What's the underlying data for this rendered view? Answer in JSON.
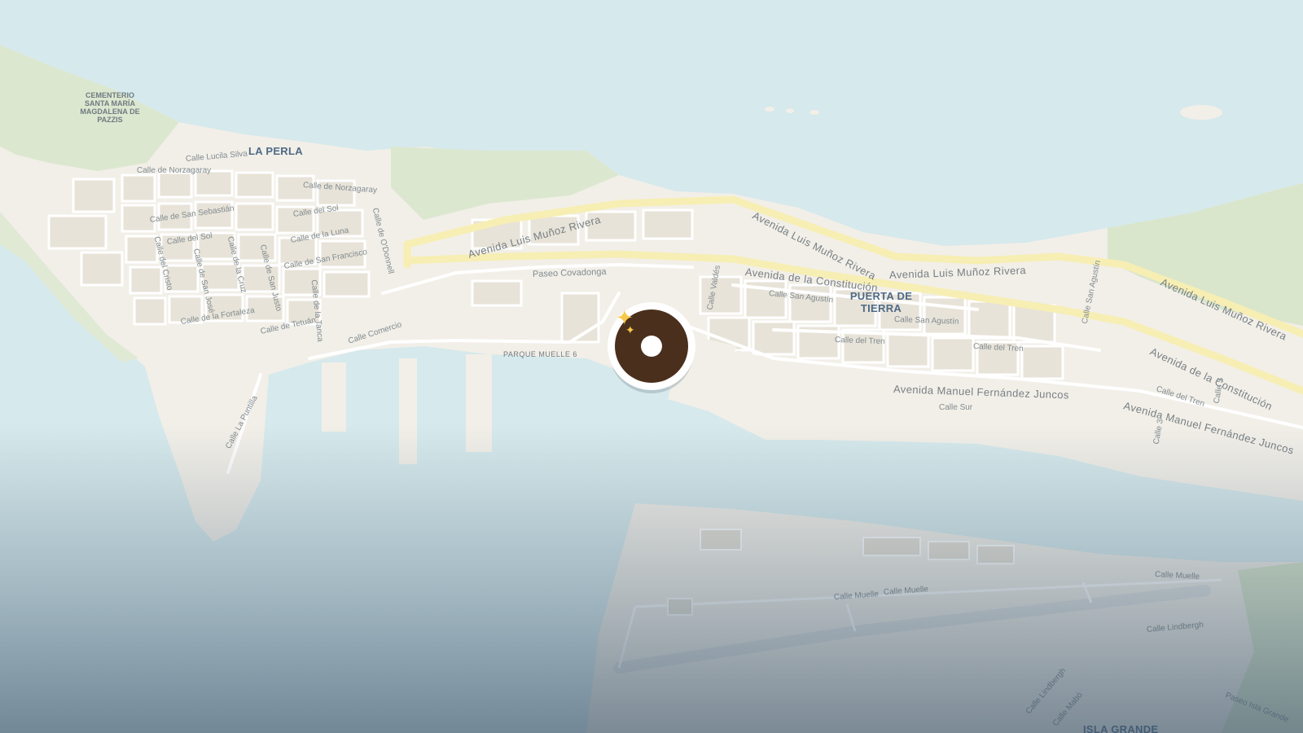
{
  "map": {
    "colors": {
      "water": "#d6e9ec",
      "land": "#f2efe8",
      "park": "#d9e6cc",
      "major_road": "#f7eeb4",
      "building": "#e6e1d6"
    },
    "neighborhoods": [
      "LA PERLA",
      "PUERTA DE TIERRA",
      "ISLA GRANDE"
    ],
    "poi": {
      "cemetery": "CEMENTERIO SANTA MARÍA MAGDALENA DE PAZZIS",
      "pier": "PARQUE MUELLE 6"
    },
    "roads": {
      "lucila_silva": "Calle Lucila Silva",
      "norzagaray_1": "Calle de Norzagaray",
      "norzagaray_2": "Calle de Norzagaray",
      "san_sebastian": "Calle de San Sebastián",
      "del_sol_1": "Calle del Sol",
      "del_sol_2": "Calle del Sol",
      "luna": "Calle de la Luna",
      "san_francisco": "Calle de San Francisco",
      "fortaleza": "Calle de la Fortaleza",
      "tetuan": "Calle de Tetuán",
      "comercio": "Calle Comercio",
      "cristo": "Calle del Cristo",
      "san_jose": "Calle de San José",
      "cruz": "Calle de la Cruz",
      "san_justo": "Calle de San Justo",
      "tanca": "Calle de la Tanca",
      "odonnell": "Calle de O'Donnell",
      "la_puntilla": "Calle La Puntilla",
      "covadonga": "Paseo Covadonga",
      "munoz_rivera_1": "Avenida Luis Muñoz Rivera",
      "munoz_rivera_2": "Avenida Luis Muñoz Rivera",
      "munoz_rivera_3": "Avenida Luis Muñoz Rivera",
      "munoz_rivera_4": "Avenida Luis Muñoz Rivera",
      "constitucion_1": "Avenida de la Constitución",
      "constitucion_2": "Avenida de la Constitución",
      "fernandez_juncos_1": "Avenida Manuel Fernández Juncos",
      "fernandez_juncos_2": "Avenida Manuel Fernández Juncos",
      "valdes": "Calle Valdés",
      "san_agustin_1": "Calle San Agustín",
      "san_agustin_2": "Calle San Agustín",
      "san_agustin_3": "Calle San Agustín",
      "del_tren_1": "Calle del Tren",
      "del_tren_2": "Calle del Tren",
      "del_tren_3": "Calle del Tren",
      "calle_sur": "Calle Sur",
      "calle_s": "Calle S",
      "calle_3": "Calle 3",
      "muelle_1": "Calle Muelle",
      "muelle_2": "Calle Muelle",
      "muelle_3": "Calle Muelle",
      "lindbergh_1": "Calle Lindbergh",
      "lindbergh_2": "Calle Lindbergh",
      "mabo": "Calle Mabó",
      "isla_grande_paseo": "Paseo Isla Grande"
    },
    "marker": {
      "icon": "sparkles-icon",
      "color": "#4a2f1d",
      "accent": "#f7c948"
    }
  }
}
